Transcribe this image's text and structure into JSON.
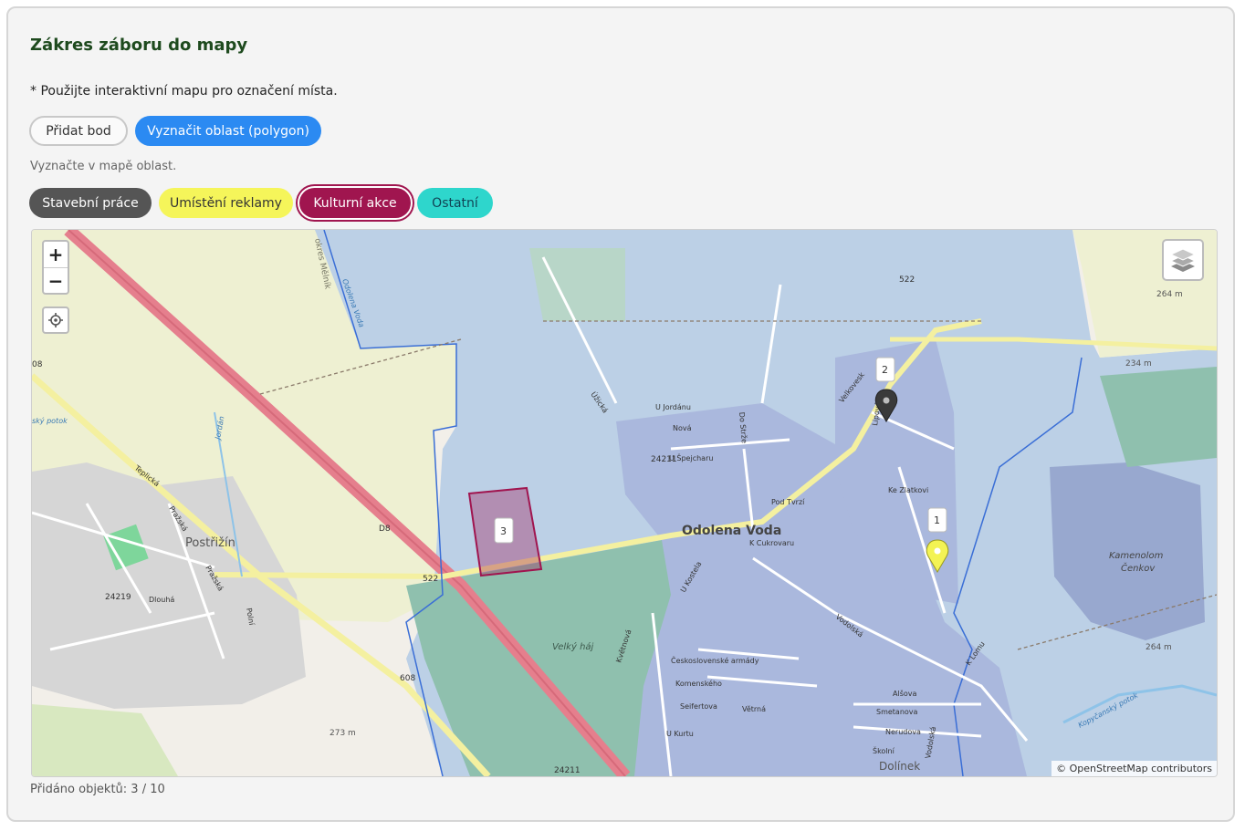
{
  "title": "Zákres záboru do mapy",
  "instruction": "* Použijte interaktivní mapu pro označení místa.",
  "modes": {
    "add_point": "Přidat bod",
    "draw_polygon": "Vyznačit oblast (polygon)",
    "active": "draw_polygon"
  },
  "mode_hint": "Vyznačte v mapě oblast.",
  "categories": [
    {
      "label": "Stavební práce",
      "color": "#555555"
    },
    {
      "label": "Umístění reklamy",
      "color": "#f5f55a"
    },
    {
      "label": "Kulturní akce",
      "color": "#a0154f",
      "selected": true
    },
    {
      "label": "Ostatní",
      "color": "#2ed6cc"
    }
  ],
  "map": {
    "controls": {
      "zoom_in": "+",
      "zoom_out": "−"
    },
    "labels": {
      "town_main": "Odolena Voda",
      "town_west": "Postřižín",
      "quarry": "Kamenolom Čenkov",
      "forest": "Velký háj",
      "district_south": "Dolínek",
      "district_border": "okres Mělník",
      "stream_left": "ský potok",
      "stream_right": "Kopyčanský potok",
      "river_jordan": "Jordán",
      "stream_odolena": "Odolena Voda",
      "road_522": "522",
      "road_522b": "522",
      "road_d8": "D8",
      "road_08": "08",
      "road_608": "608",
      "road_24211": "24211",
      "road_24211b": "24211",
      "road_24219": "24219",
      "alt_264a": "264 m",
      "alt_234": "234 m",
      "alt_264b": "264 m",
      "alt_273": "273 m",
      "street_teplicka": "Teplická",
      "street_pod_lesem": "Pražská",
      "street_velkovesk": "Velkovesk",
      "street_vodolska": "Vodolská",
      "street_ujordanu": "U Jordánu",
      "street_nova": "Nová",
      "street_dostrzi": "Do Strže",
      "street_uspejcharu": "U Špejcharu",
      "street_kvetnova": "Květnová",
      "street_ceskoslovenske": "Československé armády",
      "street_komenskeho": "Komenského",
      "street_seifertova": "Seifertova",
      "street_vetrna": "Větrná",
      "street_ukurtu": "U Kurtu",
      "street_smetanova": "Smetanova",
      "street_nerudova": "Nerudova",
      "street_skolni": "Školní",
      "street_alsova": "Alšova",
      "street_vodolska2": "Vodolská",
      "street_klomu": "K Lomu",
      "street_lipova": "Lipová",
      "street_kezlatkovi": "Ke Zlatkovi",
      "street_podtvrzi": "Pod Tvrzí",
      "street_kcukrovaru": "K Cukrovaru",
      "street_ukostela": "U Kostela",
      "street_dlouha": "Dlouhá",
      "street_prazska2": "Pražská",
      "street_polni": "Polní",
      "street_uzicka": "Úžická"
    },
    "markers": [
      {
        "id": "1",
        "category": "Umístění reklamy"
      },
      {
        "id": "2",
        "category": "Stavební práce"
      },
      {
        "id": "3",
        "category": "Kulturní akce"
      }
    ],
    "attribution": "© OpenStreetMap contributors"
  },
  "counter": {
    "label": "Přidáno objektů: 3 / 10",
    "added": 3,
    "max": 10
  }
}
